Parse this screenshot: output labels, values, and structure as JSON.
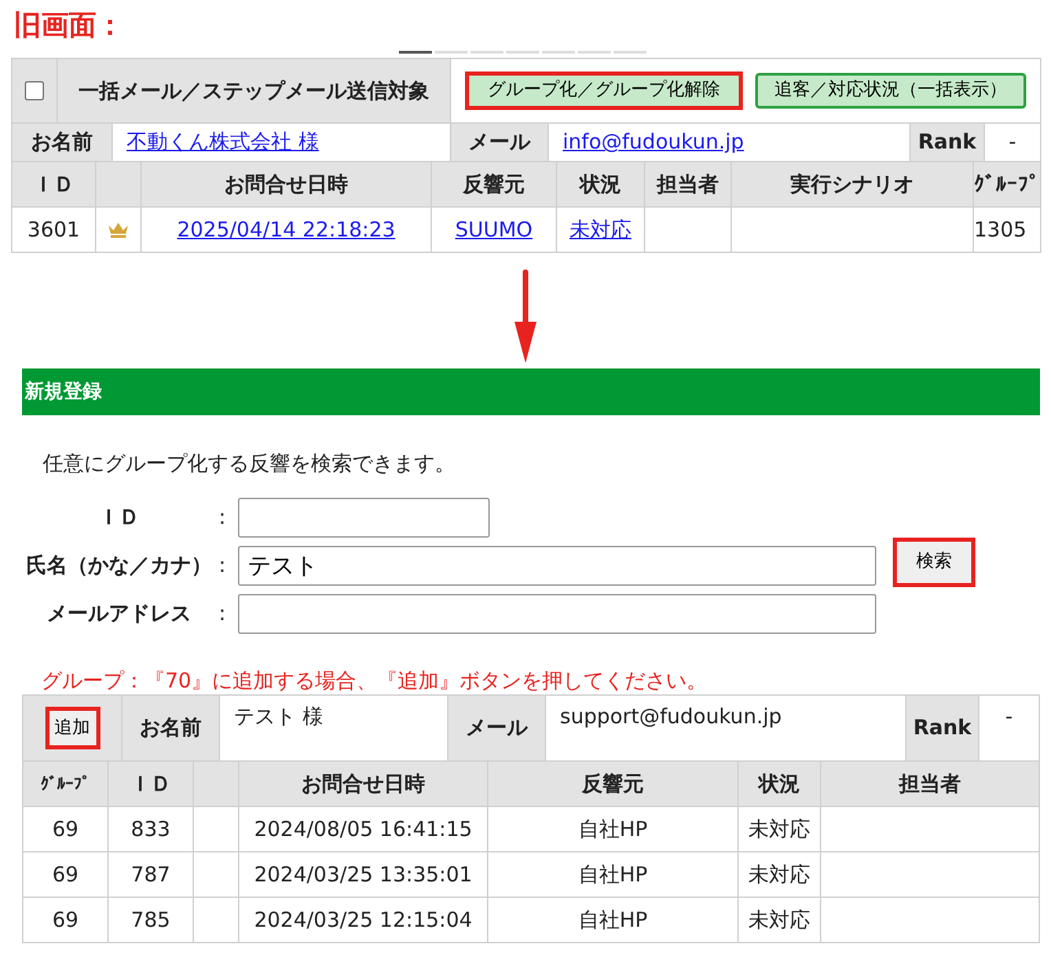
{
  "heading": "旧画面：",
  "pager": [
    {
      "selected": true
    },
    {
      "selected": false
    },
    {
      "selected": false
    },
    {
      "selected": false
    },
    {
      "selected": false
    },
    {
      "selected": false
    },
    {
      "selected": false
    }
  ],
  "old_panel": {
    "bulk_checkbox": {
      "checked": false
    },
    "bulk_label": "一括メール／ステップメール送信対象",
    "buttons": [
      {
        "label": "グループ化／グループ化解除",
        "highlighted": true
      },
      {
        "label": "追客／対応状況（一括表示）",
        "highlighted": false
      }
    ],
    "name_label": "お名前",
    "name": "不動くん株式会社 様",
    "mail_label": "メール",
    "mail": "info@fudoukun.jp",
    "rank_label": "Rank",
    "rank": "-",
    "columns": [
      "ＩＤ",
      "お問合せ日時",
      "反響元",
      "状況",
      "担当者",
      "実行シナリオ",
      "ｸﾞﾙｰﾌﾟ"
    ],
    "rows": [
      {
        "id": "3601",
        "crowned": true,
        "date": "2025/04/14 22:18:23",
        "source": "SUUMO",
        "status": "未対応",
        "group": "1305"
      }
    ]
  },
  "new_panel": {
    "title": "新規登録",
    "intro": "任意にグループ化する反響を検索できます。",
    "fields": [
      {
        "label": "ＩＤ",
        "colon": ":"
      },
      {
        "label": "氏名（かな／カナ）",
        "colon": ":",
        "value": "テスト"
      },
      {
        "label": "メールアドレス",
        "colon": ":"
      }
    ],
    "search_button": {
      "label": "検索",
      "highlighted": true
    },
    "note": "グループ：『70』に追加する場合、『追加』ボタンを押してください。",
    "add_button": {
      "label": "追加",
      "highlighted": true
    },
    "name_label": "お名前",
    "name": "テスト 様",
    "mail_label": "メール",
    "mail": "support@fudoukun.jp",
    "rank_label": "Rank",
    "rank": "-",
    "columns": [
      "ｸﾞﾙｰﾌﾟ",
      "ＩＤ",
      "お問合せ日時",
      "反響元",
      "状況",
      "担当者"
    ],
    "rows": [
      {
        "group": "69",
        "id": "833",
        "date": "2024/08/05 16:41:15",
        "source": "自社HP",
        "status": "未対応"
      },
      {
        "group": "69",
        "id": "787",
        "date": "2024/03/25 13:35:01",
        "source": "自社HP",
        "status": "未対応"
      },
      {
        "group": "69",
        "id": "785",
        "date": "2024/03/25 12:15:04",
        "source": "自社HP",
        "status": "未対応"
      }
    ]
  }
}
